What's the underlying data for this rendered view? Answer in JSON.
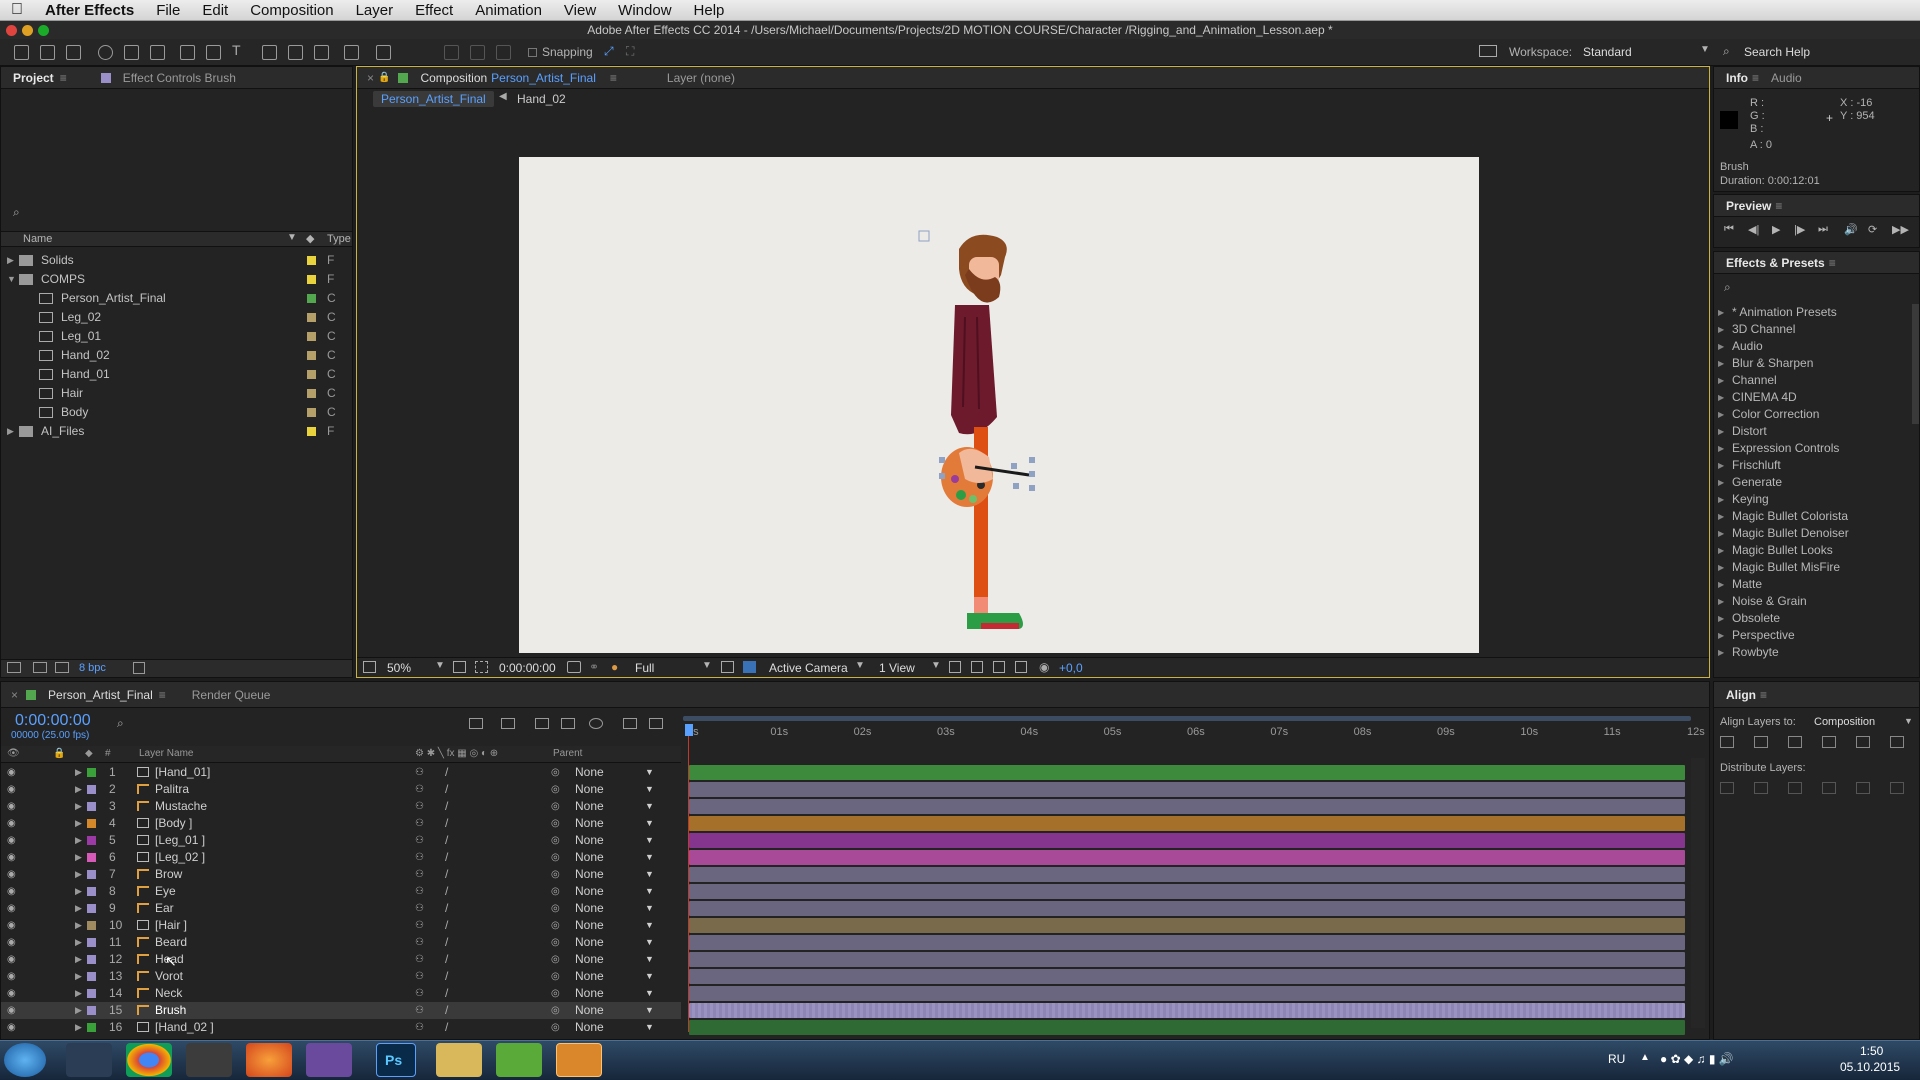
{
  "menubar": {
    "app": "After Effects",
    "items": [
      "File",
      "Edit",
      "Composition",
      "Layer",
      "Effect",
      "Animation",
      "View",
      "Window",
      "Help"
    ]
  },
  "titlebar": {
    "title": "Adobe After Effects CC 2014 - /Users/Michael/Documents/Projects/2D MOTION COURSE/Character /Rigging_and_Animation_Lesson.aep *"
  },
  "toolbar": {
    "snapping": "Snapping",
    "workspace_label": "Workspace:",
    "workspace_value": "Standard",
    "search": "Search Help"
  },
  "project": {
    "tab": "Project",
    "tab2": "Effect Controls Brush",
    "col_name": "Name",
    "col_type": "Type",
    "bpc": "8 bpc",
    "items": [
      {
        "name": "Solids",
        "type": "F",
        "color": "#e8d33f"
      },
      {
        "name": "COMPS",
        "type": "F",
        "color": "#e8d33f"
      },
      {
        "name": "Person_Artist_Final",
        "type": "C",
        "color": "#53a84f"
      },
      {
        "name": "Leg_02",
        "type": "C",
        "color": "#b5a06a"
      },
      {
        "name": "Leg_01",
        "type": "C",
        "color": "#b5a06a"
      },
      {
        "name": "Hand_02",
        "type": "C",
        "color": "#b5a06a"
      },
      {
        "name": "Hand_01",
        "type": "C",
        "color": "#b5a06a"
      },
      {
        "name": "Hair",
        "type": "C",
        "color": "#b5a06a"
      },
      {
        "name": "Body",
        "type": "C",
        "color": "#b5a06a"
      },
      {
        "name": "AI_Files",
        "type": "F",
        "color": "#e8d33f"
      }
    ]
  },
  "comp": {
    "tab_prefix": "Composition",
    "tab_name": "Person_Artist_Final",
    "layer_tab": "Layer (none)",
    "crumb1": "Person_Artist_Final",
    "crumb2": "Hand_02",
    "zoom": "50%",
    "timecode": "0:00:00:00",
    "resolution": "Full",
    "camera": "Active Camera",
    "views": "1 View",
    "exposure": "+0,0"
  },
  "info": {
    "tab": "Info",
    "tab2": "Audio",
    "r": "R :",
    "g": "G :",
    "b": "B :",
    "a": "A : 0",
    "x": "X : -16",
    "y": "Y : 954",
    "layer": "Brush",
    "duration": "Duration: 0:00:12:01"
  },
  "preview": {
    "tab": "Preview"
  },
  "effects": {
    "tab": "Effects & Presets",
    "items": [
      "* Animation Presets",
      "3D Channel",
      "Audio",
      "Blur & Sharpen",
      "Channel",
      "CINEMA 4D",
      "Color Correction",
      "Distort",
      "Expression Controls",
      "Frischluft",
      "Generate",
      "Keying",
      "Magic Bullet Colorista",
      "Magic Bullet Denoiser",
      "Magic Bullet Looks",
      "Magic Bullet MisFire",
      "Matte",
      "Noise & Grain",
      "Obsolete",
      "Perspective",
      "Rowbyte"
    ]
  },
  "timeline": {
    "tab": "Person_Artist_Final",
    "tab2": "Render Queue",
    "timecode": "0:00:00:00",
    "fps": "00000 (25.00 fps)",
    "col_num": "#",
    "col_layer": "Layer Name",
    "col_parent": "Parent",
    "ruler": [
      "0s",
      "01s",
      "02s",
      "03s",
      "04s",
      "05s",
      "06s",
      "07s",
      "08s",
      "09s",
      "10s",
      "11s",
      "12s"
    ],
    "layers": [
      {
        "num": "1",
        "name": "[Hand_01]",
        "parent": "None",
        "color": "#3aa13a",
        "bar": "#3d8a3d",
        "type": "comp"
      },
      {
        "num": "2",
        "name": "Palitra",
        "parent": "None",
        "color": "#9b8fc9",
        "bar": "#6a6680",
        "type": "shape"
      },
      {
        "num": "3",
        "name": "Mustache",
        "parent": "None",
        "color": "#9b8fc9",
        "bar": "#6a6680",
        "type": "shape"
      },
      {
        "num": "4",
        "name": "[Body ]",
        "parent": "None",
        "color": "#d4882a",
        "bar": "#a5712a",
        "type": "comp"
      },
      {
        "num": "5",
        "name": "[Leg_01 ]",
        "parent": "None",
        "color": "#9b3aa5",
        "bar": "#86358f",
        "type": "comp"
      },
      {
        "num": "6",
        "name": "[Leg_02 ]",
        "parent": "None",
        "color": "#d65ab8",
        "bar": "#a84a98",
        "type": "comp"
      },
      {
        "num": "7",
        "name": "Brow",
        "parent": "None",
        "color": "#9b8fc9",
        "bar": "#6a6680",
        "type": "shape"
      },
      {
        "num": "8",
        "name": "Eye",
        "parent": "None",
        "color": "#9b8fc9",
        "bar": "#6a6680",
        "type": "shape"
      },
      {
        "num": "9",
        "name": "Ear",
        "parent": "None",
        "color": "#9b8fc9",
        "bar": "#6a6680",
        "type": "shape"
      },
      {
        "num": "10",
        "name": "[Hair ]",
        "parent": "None",
        "color": "#a08a60",
        "bar": "#7a6a4c",
        "type": "comp"
      },
      {
        "num": "11",
        "name": "Beard",
        "parent": "None",
        "color": "#9b8fc9",
        "bar": "#6a6680",
        "type": "shape"
      },
      {
        "num": "12",
        "name": "Head",
        "parent": "None",
        "color": "#9b8fc9",
        "bar": "#6a6680",
        "type": "shape"
      },
      {
        "num": "13",
        "name": "Vorot",
        "parent": "None",
        "color": "#9b8fc9",
        "bar": "#6a6680",
        "type": "shape"
      },
      {
        "num": "14",
        "name": "Neck",
        "parent": "None",
        "color": "#9b8fc9",
        "bar": "#6a6680",
        "type": "shape"
      },
      {
        "num": "15",
        "name": "Brush",
        "parent": "None",
        "color": "#9b8fc9",
        "bar": "#8e86b4",
        "type": "shape"
      },
      {
        "num": "16",
        "name": "[Hand_02 ]",
        "parent": "None",
        "color": "#3aa13a",
        "bar": "#2f6a35",
        "type": "comp"
      }
    ]
  },
  "align": {
    "tab": "Align",
    "align_to_label": "Align Layers to:",
    "align_to_value": "Composition",
    "distribute": "Distribute Layers:"
  },
  "taskbar": {
    "lang": "RU",
    "time": "1:50",
    "date": "05.10.2015"
  }
}
